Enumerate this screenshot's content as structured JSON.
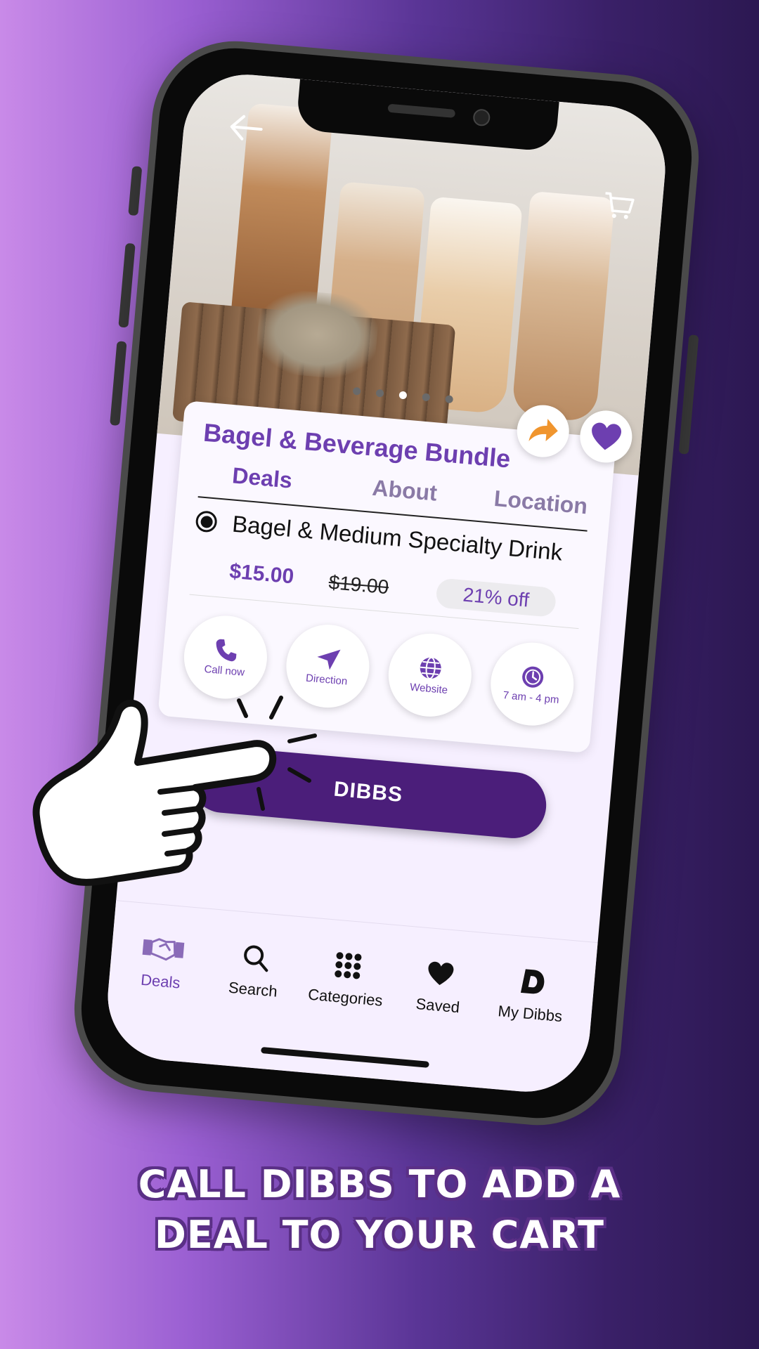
{
  "deal": {
    "title": "Bagel & Beverage Bundle",
    "tabs": [
      "Deals",
      "About",
      "Location"
    ],
    "option_label": "Bagel & Medium Specialty Drink",
    "price": "$15.00",
    "old_price": "$19.00",
    "discount": "21% off",
    "image_count": 5,
    "active_image": 3
  },
  "actions": [
    {
      "label": "Call now",
      "icon": "phone-icon"
    },
    {
      "label": "Direction",
      "icon": "direction-icon"
    },
    {
      "label": "Website",
      "icon": "globe-icon"
    },
    {
      "label": "7 am - 4 pm",
      "icon": "clock-icon"
    }
  ],
  "dibbs_button": {
    "label": "DIBBS"
  },
  "nav": [
    {
      "label": "Deals",
      "icon": "handshake-icon",
      "active": true
    },
    {
      "label": "Search",
      "icon": "search-icon"
    },
    {
      "label": "Categories",
      "icon": "grid-icon"
    },
    {
      "label": "Saved",
      "icon": "heart-icon"
    },
    {
      "label": "My Dibbs",
      "icon": "dibbs-logo-icon"
    }
  ],
  "caption": {
    "line1": "CALL DIBBS TO ADD A",
    "line2": "DEAL TO YOUR CART"
  },
  "colors": {
    "brand_purple": "#6d3fb0",
    "button_purple": "#4b1e7a",
    "share_orange": "#f0952e"
  }
}
